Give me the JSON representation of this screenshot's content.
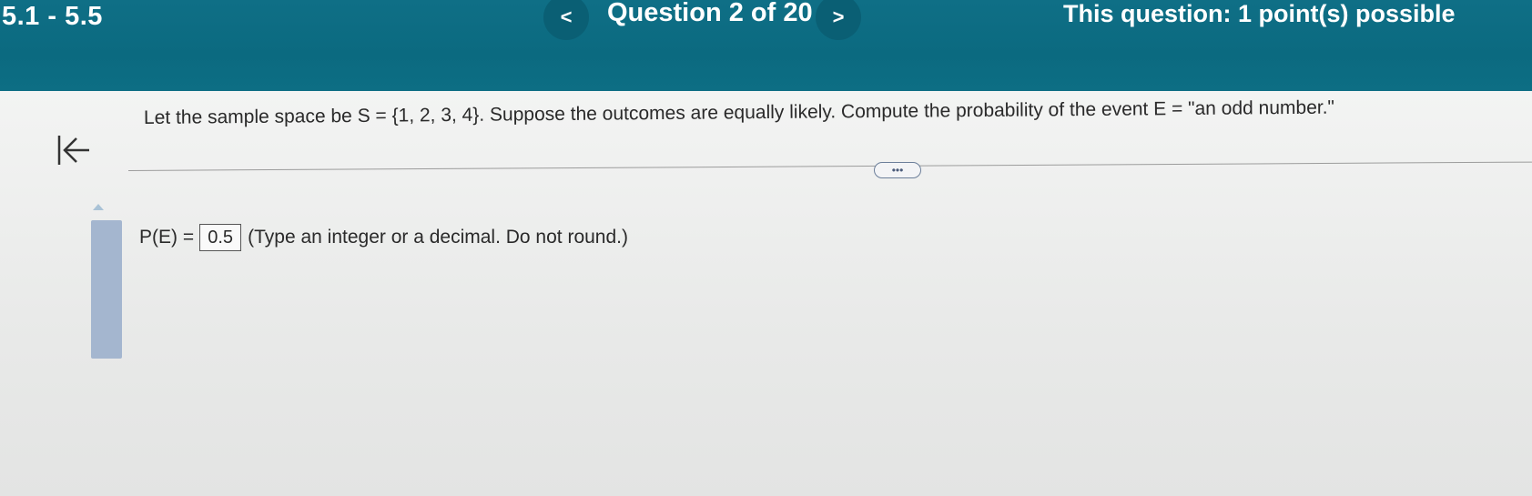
{
  "header": {
    "section": "5.1 - 5.5",
    "prev_label": "<",
    "question_counter": "Question 2 of 20",
    "next_label": ">",
    "points": "This question: 1 point(s) possible"
  },
  "colors": {
    "header_bg": "#0b6a80",
    "scroll_thumb": "#a4b6cf"
  },
  "question": {
    "prompt": "Let the sample space be S = {1, 2, 3, 4}. Suppose the outcomes are equally likely. Compute the probability of the event E = \"an odd number.\"",
    "more_label": "•••"
  },
  "answer": {
    "prefix": "P(E) =",
    "value": "0.5",
    "instruction": "(Type an integer or a decimal. Do not round.)"
  },
  "icons": {
    "back": "back-to-start-icon",
    "scroll": "scroll-up-icon"
  }
}
